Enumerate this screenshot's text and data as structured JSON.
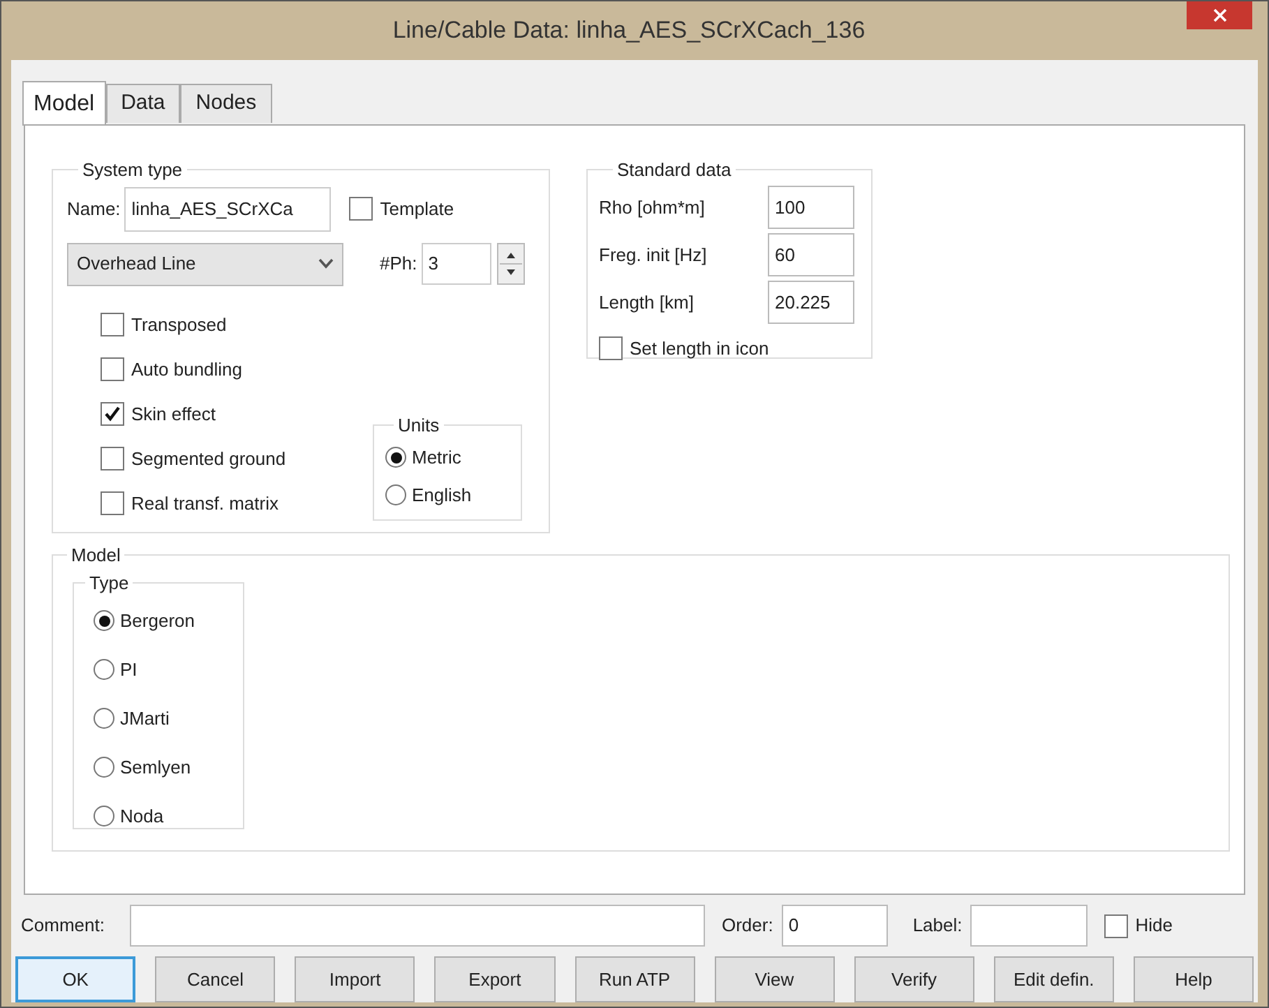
{
  "window": {
    "title": "Line/Cable Data: linha_AES_SCrXCach_136"
  },
  "tabs": [
    {
      "label": "Model",
      "selected": true
    },
    {
      "label": "Data",
      "selected": false
    },
    {
      "label": "Nodes",
      "selected": false
    }
  ],
  "system_type": {
    "legend": "System type",
    "name_label": "Name:",
    "name_value": "linha_AES_SCrXCa",
    "template": {
      "label": "Template",
      "checked": false
    },
    "line_type": "Overhead Line",
    "phases_label": "#Ph:",
    "phases_value": "3",
    "options": [
      {
        "label": "Transposed",
        "checked": false
      },
      {
        "label": "Auto bundling",
        "checked": false
      },
      {
        "label": "Skin effect",
        "checked": true
      },
      {
        "label": "Segmented ground",
        "checked": false
      },
      {
        "label": "Real transf. matrix",
        "checked": false
      }
    ],
    "units": {
      "legend": "Units",
      "options": [
        {
          "label": "Metric",
          "selected": true
        },
        {
          "label": "English",
          "selected": false
        }
      ]
    }
  },
  "standard_data": {
    "legend": "Standard data",
    "fields": [
      {
        "label": "Rho [ohm*m]",
        "value": "100"
      },
      {
        "label": "Freg. init [Hz]",
        "value": "60"
      },
      {
        "label": "Length [km]",
        "value": "20.225"
      }
    ],
    "set_length": {
      "label": "Set length in icon",
      "checked": false
    }
  },
  "model": {
    "legend": "Model",
    "type": {
      "legend": "Type",
      "options": [
        {
          "label": "Bergeron",
          "selected": true
        },
        {
          "label": "PI",
          "selected": false
        },
        {
          "label": "JMarti",
          "selected": false
        },
        {
          "label": "Semlyen",
          "selected": false
        },
        {
          "label": "Noda",
          "selected": false
        }
      ]
    }
  },
  "footer": {
    "comment_label": "Comment:",
    "order_label": "Order:",
    "order_value": "0",
    "label_label": "Label:",
    "hide": {
      "label": "Hide",
      "checked": false
    }
  },
  "buttons": [
    {
      "label": "OK",
      "focused": true
    },
    {
      "label": "Cancel",
      "focused": false
    },
    {
      "label": "Import",
      "focused": false
    },
    {
      "label": "Export",
      "focused": false
    },
    {
      "label": "Run ATP",
      "focused": false
    },
    {
      "label": "View",
      "focused": false
    },
    {
      "label": "Verify",
      "focused": false
    },
    {
      "label": "Edit defin.",
      "focused": false
    },
    {
      "label": "Help",
      "focused": false
    }
  ]
}
